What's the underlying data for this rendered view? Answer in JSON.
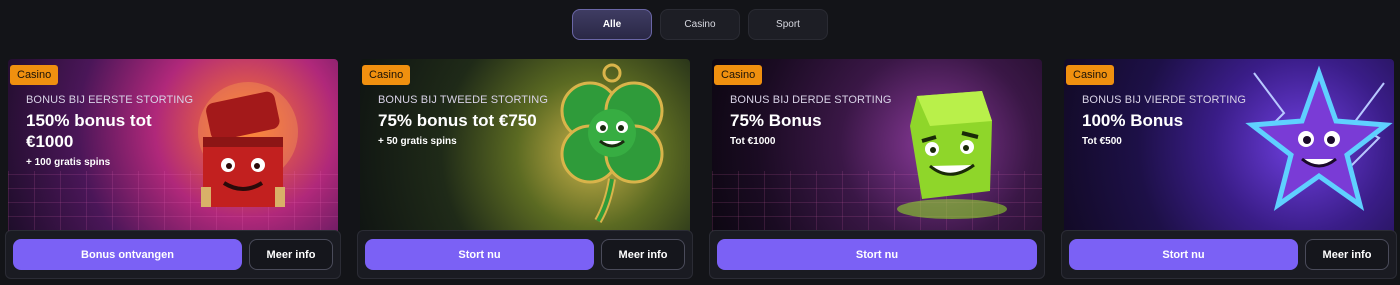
{
  "filters": [
    {
      "label": "Alle",
      "active": true
    },
    {
      "label": "Casino",
      "active": false
    },
    {
      "label": "Sport",
      "active": false
    }
  ],
  "cards": [
    {
      "badge": "Casino",
      "eyebrow": "BONUS BIJ EERSTE STORTING",
      "headline": "150% bonus tot €1000",
      "sub": "+ 100 gratis spins",
      "primary": "Bonus ontvangen",
      "secondary": "Meer info",
      "art": "treasure-chest-icon"
    },
    {
      "badge": "Casino",
      "eyebrow": "BONUS BIJ TWEEDE STORTING",
      "headline": "75% bonus tot €750",
      "sub": "+ 50 gratis spins",
      "primary": "Stort nu",
      "secondary": "Meer info",
      "art": "clover-icon"
    },
    {
      "badge": "Casino",
      "eyebrow": "BONUS BIJ DERDE STORTING",
      "headline": "75% Bonus",
      "sub": "Tot €1000",
      "primary": "Stort nu",
      "secondary": null,
      "art": "slime-cube-icon"
    },
    {
      "badge": "Casino",
      "eyebrow": "BONUS BIJ VIERDE STORTING",
      "headline": "100% Bonus",
      "sub": "Tot €500",
      "primary": "Stort nu",
      "secondary": "Meer info",
      "art": "lightning-star-icon"
    }
  ],
  "colors": {
    "accent": "#7b61f5",
    "badge": "#f0900f",
    "background": "#131418"
  }
}
